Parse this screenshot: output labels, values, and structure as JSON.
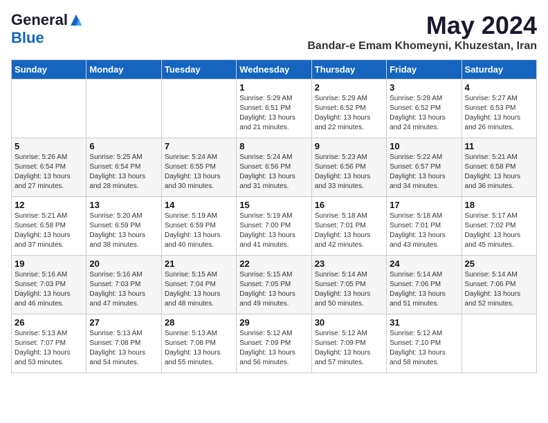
{
  "logo": {
    "general": "General",
    "blue": "Blue"
  },
  "title": {
    "month_year": "May 2024",
    "location": "Bandar-e Emam Khomeyni, Khuzestan, Iran"
  },
  "weekdays": [
    "Sunday",
    "Monday",
    "Tuesday",
    "Wednesday",
    "Thursday",
    "Friday",
    "Saturday"
  ],
  "weeks": [
    [
      {
        "day": "",
        "info": ""
      },
      {
        "day": "",
        "info": ""
      },
      {
        "day": "",
        "info": ""
      },
      {
        "day": "1",
        "info": "Sunrise: 5:29 AM\nSunset: 6:51 PM\nDaylight: 13 hours\nand 21 minutes."
      },
      {
        "day": "2",
        "info": "Sunrise: 5:29 AM\nSunset: 6:52 PM\nDaylight: 13 hours\nand 22 minutes."
      },
      {
        "day": "3",
        "info": "Sunrise: 5:28 AM\nSunset: 6:52 PM\nDaylight: 13 hours\nand 24 minutes."
      },
      {
        "day": "4",
        "info": "Sunrise: 5:27 AM\nSunset: 6:53 PM\nDaylight: 13 hours\nand 26 minutes."
      }
    ],
    [
      {
        "day": "5",
        "info": "Sunrise: 5:26 AM\nSunset: 6:54 PM\nDaylight: 13 hours\nand 27 minutes."
      },
      {
        "day": "6",
        "info": "Sunrise: 5:25 AM\nSunset: 6:54 PM\nDaylight: 13 hours\nand 28 minutes."
      },
      {
        "day": "7",
        "info": "Sunrise: 5:24 AM\nSunset: 6:55 PM\nDaylight: 13 hours\nand 30 minutes."
      },
      {
        "day": "8",
        "info": "Sunrise: 5:24 AM\nSunset: 6:56 PM\nDaylight: 13 hours\nand 31 minutes."
      },
      {
        "day": "9",
        "info": "Sunrise: 5:23 AM\nSunset: 6:56 PM\nDaylight: 13 hours\nand 33 minutes."
      },
      {
        "day": "10",
        "info": "Sunrise: 5:22 AM\nSunset: 6:57 PM\nDaylight: 13 hours\nand 34 minutes."
      },
      {
        "day": "11",
        "info": "Sunrise: 5:21 AM\nSunset: 6:58 PM\nDaylight: 13 hours\nand 36 minutes."
      }
    ],
    [
      {
        "day": "12",
        "info": "Sunrise: 5:21 AM\nSunset: 6:58 PM\nDaylight: 13 hours\nand 37 minutes."
      },
      {
        "day": "13",
        "info": "Sunrise: 5:20 AM\nSunset: 6:59 PM\nDaylight: 13 hours\nand 38 minutes."
      },
      {
        "day": "14",
        "info": "Sunrise: 5:19 AM\nSunset: 6:59 PM\nDaylight: 13 hours\nand 40 minutes."
      },
      {
        "day": "15",
        "info": "Sunrise: 5:19 AM\nSunset: 7:00 PM\nDaylight: 13 hours\nand 41 minutes."
      },
      {
        "day": "16",
        "info": "Sunrise: 5:18 AM\nSunset: 7:01 PM\nDaylight: 13 hours\nand 42 minutes."
      },
      {
        "day": "17",
        "info": "Sunrise: 5:18 AM\nSunset: 7:01 PM\nDaylight: 13 hours\nand 43 minutes."
      },
      {
        "day": "18",
        "info": "Sunrise: 5:17 AM\nSunset: 7:02 PM\nDaylight: 13 hours\nand 45 minutes."
      }
    ],
    [
      {
        "day": "19",
        "info": "Sunrise: 5:16 AM\nSunset: 7:03 PM\nDaylight: 13 hours\nand 46 minutes."
      },
      {
        "day": "20",
        "info": "Sunrise: 5:16 AM\nSunset: 7:03 PM\nDaylight: 13 hours\nand 47 minutes."
      },
      {
        "day": "21",
        "info": "Sunrise: 5:15 AM\nSunset: 7:04 PM\nDaylight: 13 hours\nand 48 minutes."
      },
      {
        "day": "22",
        "info": "Sunrise: 5:15 AM\nSunset: 7:05 PM\nDaylight: 13 hours\nand 49 minutes."
      },
      {
        "day": "23",
        "info": "Sunrise: 5:14 AM\nSunset: 7:05 PM\nDaylight: 13 hours\nand 50 minutes."
      },
      {
        "day": "24",
        "info": "Sunrise: 5:14 AM\nSunset: 7:06 PM\nDaylight: 13 hours\nand 51 minutes."
      },
      {
        "day": "25",
        "info": "Sunrise: 5:14 AM\nSunset: 7:06 PM\nDaylight: 13 hours\nand 52 minutes."
      }
    ],
    [
      {
        "day": "26",
        "info": "Sunrise: 5:13 AM\nSunset: 7:07 PM\nDaylight: 13 hours\nand 53 minutes."
      },
      {
        "day": "27",
        "info": "Sunrise: 5:13 AM\nSunset: 7:08 PM\nDaylight: 13 hours\nand 54 minutes."
      },
      {
        "day": "28",
        "info": "Sunrise: 5:13 AM\nSunset: 7:08 PM\nDaylight: 13 hours\nand 55 minutes."
      },
      {
        "day": "29",
        "info": "Sunrise: 5:12 AM\nSunset: 7:09 PM\nDaylight: 13 hours\nand 56 minutes."
      },
      {
        "day": "30",
        "info": "Sunrise: 5:12 AM\nSunset: 7:09 PM\nDaylight: 13 hours\nand 57 minutes."
      },
      {
        "day": "31",
        "info": "Sunrise: 5:12 AM\nSunset: 7:10 PM\nDaylight: 13 hours\nand 58 minutes."
      },
      {
        "day": "",
        "info": ""
      }
    ]
  ]
}
